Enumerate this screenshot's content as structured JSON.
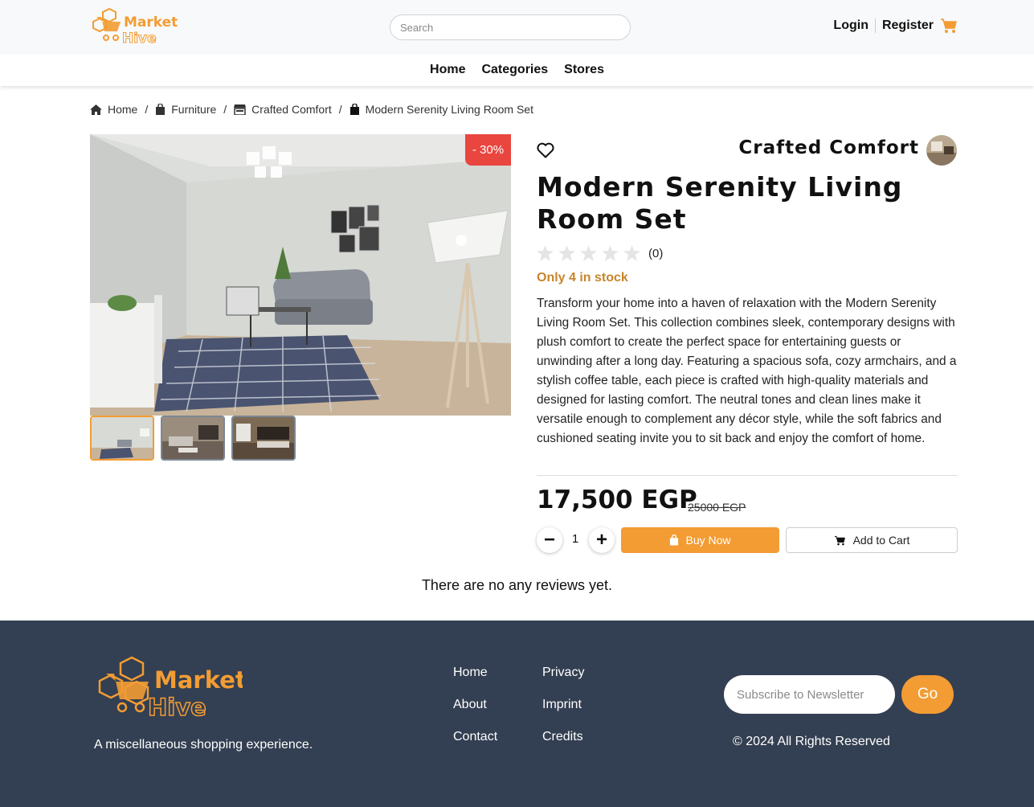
{
  "header": {
    "logo_text_1": "Market",
    "logo_text_2": "Hive",
    "search_placeholder": "Search",
    "login_label": "Login",
    "register_label": "Register"
  },
  "nav": {
    "items": [
      "Home",
      "Categories",
      "Stores"
    ]
  },
  "breadcrumb": [
    "Home",
    "Furniture",
    "Crafted Comfort",
    "Modern Serenity Living Room Set"
  ],
  "product": {
    "discount": "- 30%",
    "store_name": "Crafted Comfort",
    "title": "Modern Serenity Living Room Set",
    "rating": 0,
    "rating_count": "(0)",
    "stock": "Only 4 in stock",
    "description": "Transform your home into a haven of relaxation with the Modern Serenity Living Room Set. This collection combines sleek, contemporary designs with plush comfort to create the perfect space for entertaining guests or unwinding after a long day. Featuring a spacious sofa, cozy armchairs, and a stylish coffee table, each piece is crafted with high-quality materials and designed for lasting comfort. The neutral tones and clean lines make it versatile enough to complement any décor style, while the soft fabrics and cushioned seating invite you to sit back and enjoy the comfort of home.",
    "price": "17,500 EGP",
    "old_price": "25000 EGP",
    "quantity": "1",
    "buy_label": "Buy Now",
    "add_cart_label": "Add to Cart",
    "minus": "−",
    "plus": "+"
  },
  "reviews": {
    "empty_text": "There are no any reviews yet."
  },
  "footer": {
    "logo_text_1": "Market",
    "logo_text_2": "Hive",
    "tagline": "A miscellaneous shopping experience.",
    "links_col1": [
      "Home",
      "About",
      "Contact"
    ],
    "links_col2": [
      "Privacy",
      "Imprint",
      "Credits"
    ],
    "newsletter_placeholder": "Subscribe to Newsletter",
    "go_label": "Go",
    "copyright": "© 2024 All Rights Reserved"
  },
  "colors": {
    "accent": "#f39c33",
    "discount": "#e8463f",
    "footer_bg": "#333f52",
    "stock": "#c8852b"
  },
  "icons": [
    "cart-icon",
    "home-icon",
    "bag-icon",
    "store-icon",
    "heart-icon",
    "star-icon"
  ]
}
